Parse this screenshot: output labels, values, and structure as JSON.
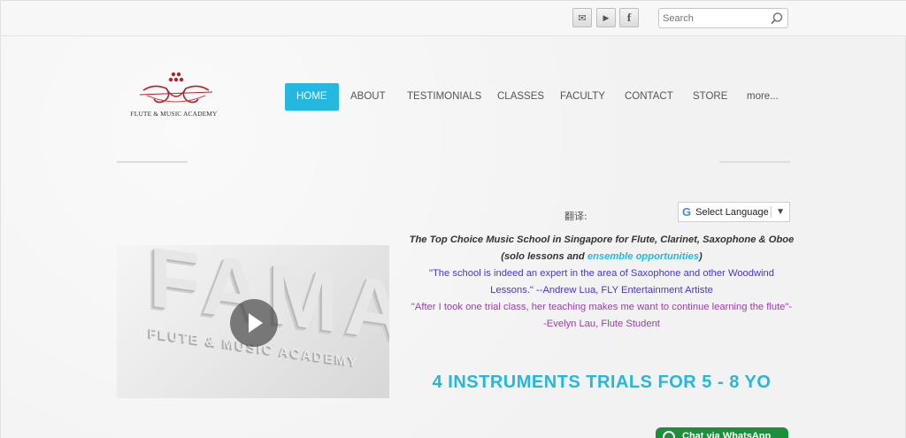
{
  "header": {
    "social": [
      {
        "name": "email",
        "glyph": "✉"
      },
      {
        "name": "youtube",
        "glyph": "▶"
      },
      {
        "name": "facebook",
        "glyph": "f"
      }
    ],
    "search_placeholder": "Search"
  },
  "logo": {
    "text": "FLUTE & MUSIC ACADEMY"
  },
  "nav": {
    "items": [
      {
        "label": "HOME",
        "active": true
      },
      {
        "label": "ABOUT"
      },
      {
        "label": "TESTIMONIALS"
      },
      {
        "label": "CLASSES"
      },
      {
        "label": "FACULTY"
      },
      {
        "label": "CONTACT"
      },
      {
        "label": "STORE"
      },
      {
        "label": "more..."
      }
    ]
  },
  "translate": {
    "label": "翻译:",
    "g_letter": "G",
    "select_label": "Select Language",
    "arrow": "▼"
  },
  "video": {
    "big_text": "FAMA",
    "sub_text": "FLUTE & MUSIC ACADEMY"
  },
  "content": {
    "tagline": "The Top Choice Music School in Singapore for Flute, Clarinet, Saxophone & Oboe",
    "sub_prefix": "(solo lessons and ",
    "sub_link": "ensemble opportunities",
    "sub_suffix": ")",
    "quote1_line1": "\"The school is indeed an expert in the area of Saxophone and other Woodwind",
    "quote1_line2": "Lessons.\" --Andrew Lua, FLY Entertainment Artiste",
    "quote2_line1": "\"After I took one trial class, her teaching makes me want to continue learning the flute\"-",
    "quote2_line2": "-Evelyn Lau, Flute Student",
    "headline": "4 INSTRUMENTS TRIALS FOR 5 - 8 YO"
  },
  "chat": {
    "label": "Chat via WhatsApp"
  },
  "colors": {
    "accent": "#24b8e0",
    "quote1": "#4a36c9",
    "quote2": "#9b3fa8",
    "whatsapp": "#1b8f3a"
  }
}
